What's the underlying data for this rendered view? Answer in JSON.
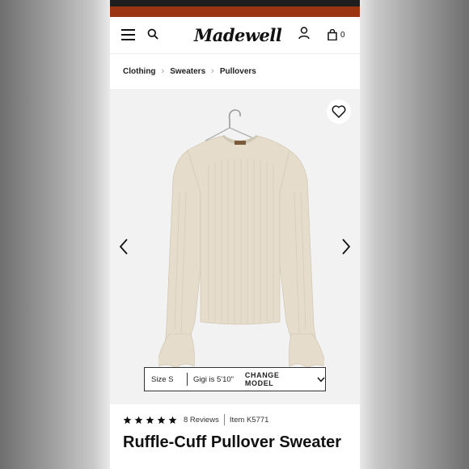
{
  "colors": {
    "top_band_red": "#9a3413",
    "top_band_dark": "#1e1e1e",
    "image_bg": "#f2f2f2",
    "sweater": "#e5dccb",
    "text": "#111111"
  },
  "header": {
    "logo": "Madewell",
    "cart_count": "0",
    "icons": [
      "menu-icon",
      "search-icon",
      "account-icon",
      "shopping-bag-icon"
    ]
  },
  "breadcrumb": [
    "Clothing",
    "Sweaters",
    "Pullovers"
  ],
  "gallery": {
    "favorite_icon": "heart-icon",
    "prev_icon": "chevron-left-icon",
    "next_icon": "chevron-right-icon"
  },
  "model_info": {
    "size": "Size S",
    "height": "Gigi is 5'10\"",
    "change_label": "CHANGE MODEL"
  },
  "product": {
    "rating": 5,
    "rating_max": 5,
    "reviews": "8 Reviews",
    "item": "Item K5771",
    "title": "Ruffle-Cuff Pullover Sweater"
  }
}
